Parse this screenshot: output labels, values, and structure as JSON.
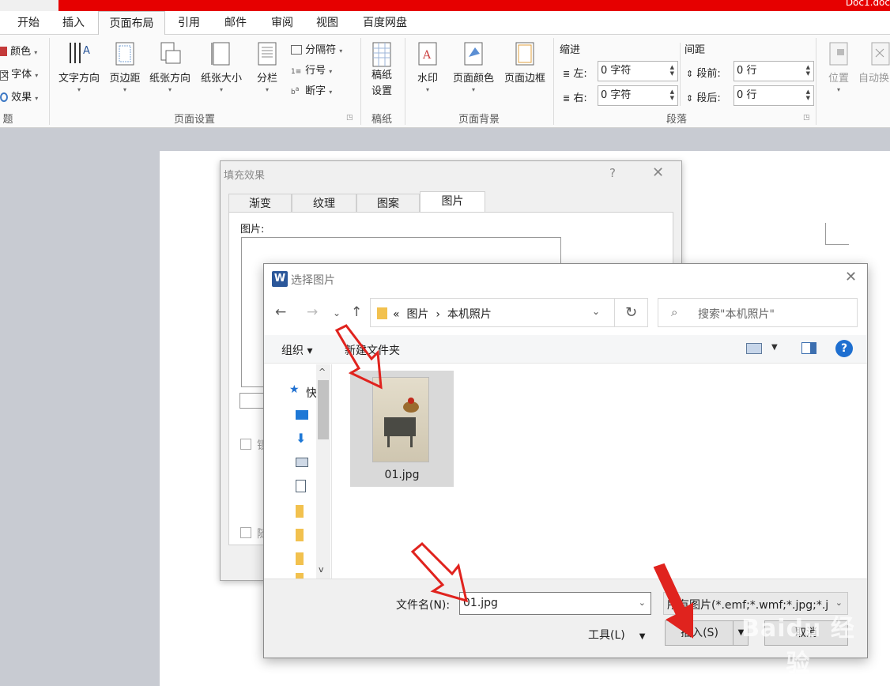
{
  "window": {
    "doc_title": "Doc1.doc"
  },
  "tabs": [
    {
      "label": "开始"
    },
    {
      "label": "插入"
    },
    {
      "label": "页面布局",
      "active": true
    },
    {
      "label": "引用"
    },
    {
      "label": "邮件"
    },
    {
      "label": "审阅"
    },
    {
      "label": "视图"
    },
    {
      "label": "百度网盘"
    }
  ],
  "ribbon": {
    "theme": {
      "colors": "颜色",
      "fonts": "字体",
      "effects": "效果",
      "group": "题"
    },
    "page_setup": {
      "text_direction": "文字方向",
      "margins": "页边距",
      "orientation": "纸张方向",
      "size": "纸张大小",
      "columns": "分栏",
      "breaks": "分隔符",
      "line_numbers": "行号",
      "hyphenation": "断字",
      "group": "页面设置"
    },
    "draft": {
      "label1": "稿纸",
      "label2": "设置",
      "group": "稿纸"
    },
    "page_background": {
      "watermark": "水印",
      "page_color": "页面颜色",
      "page_borders": "页面边框",
      "group": "页面背景"
    },
    "paragraph": {
      "indent_title": "缩进",
      "spacing_title": "间距",
      "left_label": "左:",
      "left_value": "0 字符",
      "right_label": "右:",
      "right_value": "0 字符",
      "before_label": "段前:",
      "before_value": "0 行",
      "after_label": "段后:",
      "after_value": "0 行",
      "group": "段落"
    },
    "arrange": {
      "position": "位置",
      "wrap": "自动换"
    }
  },
  "fill_dialog": {
    "title": "填充效果",
    "help": "?",
    "tabs": [
      "渐变",
      "纹理",
      "图案",
      "图片"
    ],
    "picture_label": "图片:",
    "lock_label": "锁",
    "rotate_label": "随"
  },
  "picker": {
    "title": "选择图片",
    "address": {
      "prefix": "«",
      "part1": "图片",
      "sep": "›",
      "part2": "本机照片"
    },
    "search_placeholder": "搜索\"本机照片\"",
    "organize": "组织 ▾",
    "new_folder": "新建文件夹",
    "quick_access": "快",
    "files": [
      {
        "name": "01.jpg"
      }
    ],
    "filename_label": "文件名(N):",
    "filename_value": "01.jpg",
    "filetype_value": "所有图片(*.emf;*.wmf;*.jpg;*.j",
    "tools_label": "工具(L)",
    "insert_label": "插入(S)",
    "cancel_label": "取消"
  },
  "watermark": {
    "line1": "Baidu 经验",
    "line2": "jingyan.baidu.com"
  },
  "colors": {
    "accent_red": "#e60000",
    "word_blue": "#2b579a",
    "arrow_red": "#e0231e"
  }
}
